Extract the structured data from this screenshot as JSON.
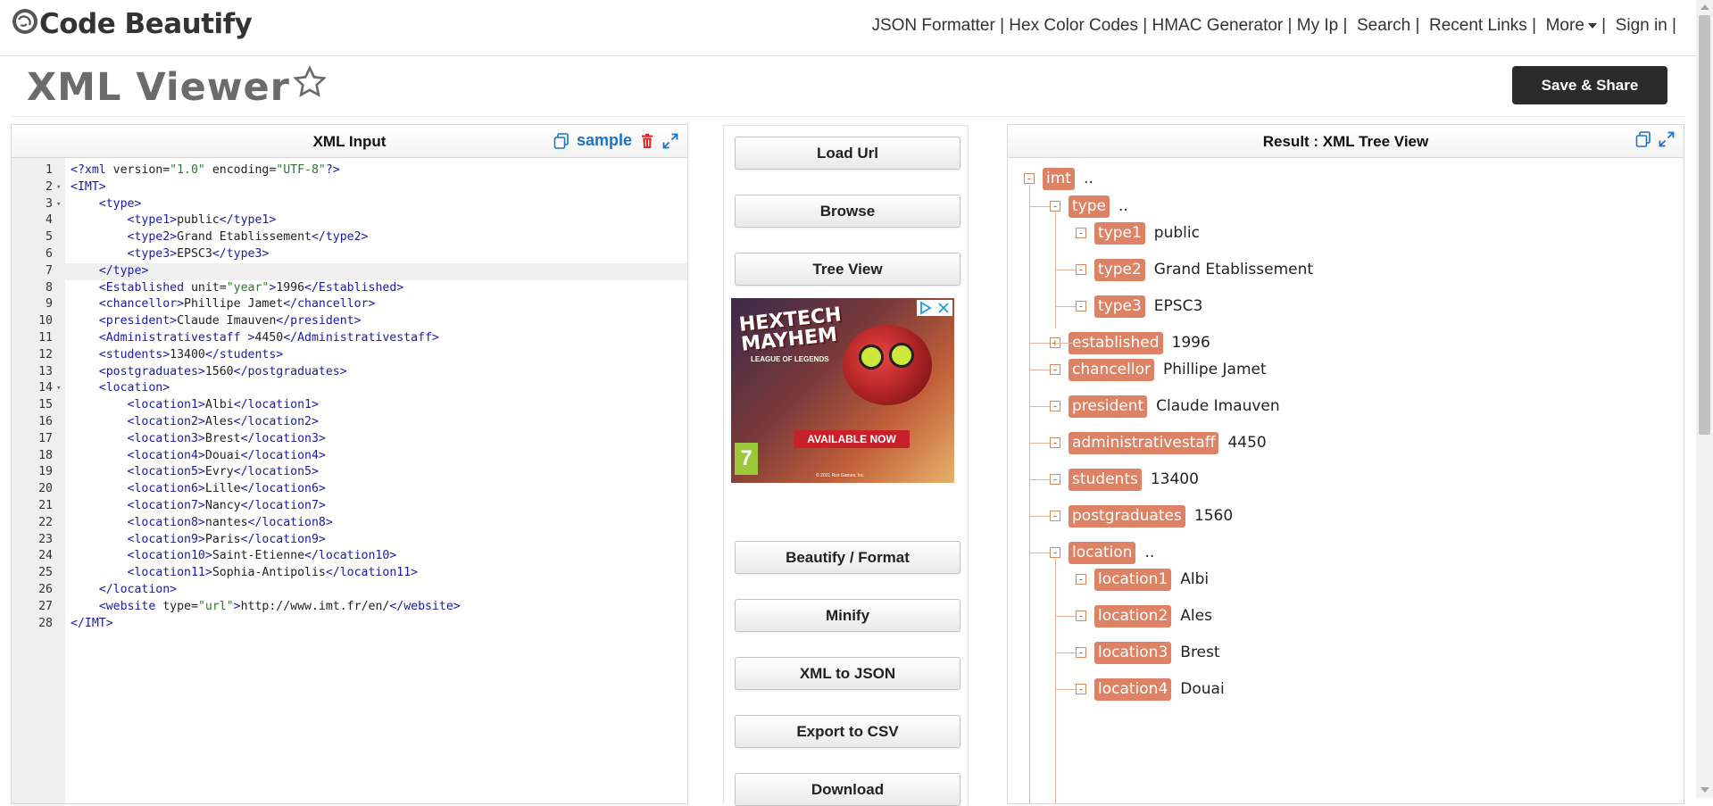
{
  "brand": {
    "name": "Code Beautify"
  },
  "nav": {
    "items": [
      "JSON Formatter",
      "Hex Color Codes",
      "HMAC Generator",
      "My Ip",
      "Search",
      "Recent Links",
      "More",
      "Sign in"
    ]
  },
  "page": {
    "title": "XML Viewer",
    "save_label": "Save & Share"
  },
  "input_panel": {
    "title": "XML Input",
    "sample_label": "sample",
    "lines": [
      {
        "n": "1",
        "fold": "",
        "segs": [
          [
            "t",
            "<?xml"
          ],
          [
            "a",
            " version="
          ],
          [
            "v",
            "\"1.0\""
          ],
          [
            "a",
            " encoding="
          ],
          [
            "v",
            "\"UTF-8\""
          ],
          [
            "t",
            "?>"
          ]
        ]
      },
      {
        "n": "2",
        "fold": "▾",
        "segs": [
          [
            "t",
            "<IMT>"
          ]
        ]
      },
      {
        "n": "3",
        "fold": "▾",
        "segs": [
          [
            "a",
            "    "
          ],
          [
            "t",
            "<type>"
          ]
        ]
      },
      {
        "n": "4",
        "fold": "",
        "segs": [
          [
            "a",
            "        "
          ],
          [
            "t",
            "<type1>"
          ],
          [
            "a",
            "public"
          ],
          [
            "t",
            "</type1>"
          ]
        ]
      },
      {
        "n": "5",
        "fold": "",
        "segs": [
          [
            "a",
            "        "
          ],
          [
            "t",
            "<type2>"
          ],
          [
            "a",
            "Grand Etablissement"
          ],
          [
            "t",
            "</type2>"
          ]
        ]
      },
      {
        "n": "6",
        "fold": "",
        "segs": [
          [
            "a",
            "        "
          ],
          [
            "t",
            "<type3>"
          ],
          [
            "a",
            "EPSC3"
          ],
          [
            "t",
            "</type3>"
          ]
        ]
      },
      {
        "n": "7",
        "fold": "",
        "segs": [
          [
            "a",
            "    "
          ],
          [
            "t",
            "</type>"
          ]
        ]
      },
      {
        "n": "8",
        "fold": "",
        "segs": [
          [
            "a",
            "    "
          ],
          [
            "t",
            "<Established"
          ],
          [
            "a",
            " unit="
          ],
          [
            "v",
            "\"year\""
          ],
          [
            "t",
            ">"
          ],
          [
            "a",
            "1996"
          ],
          [
            "t",
            "</Established>"
          ]
        ]
      },
      {
        "n": "9",
        "fold": "",
        "segs": [
          [
            "a",
            "    "
          ],
          [
            "t",
            "<chancellor>"
          ],
          [
            "a",
            "Phillipe Jamet"
          ],
          [
            "t",
            "</chancellor>"
          ]
        ]
      },
      {
        "n": "10",
        "fold": "",
        "segs": [
          [
            "a",
            "    "
          ],
          [
            "t",
            "<president>"
          ],
          [
            "a",
            "Claude Imauven"
          ],
          [
            "t",
            "</president>"
          ]
        ]
      },
      {
        "n": "11",
        "fold": "",
        "segs": [
          [
            "a",
            "    "
          ],
          [
            "t",
            "<Administrativestaff >"
          ],
          [
            "a",
            "4450"
          ],
          [
            "t",
            "</Administrativestaff>"
          ]
        ]
      },
      {
        "n": "12",
        "fold": "",
        "segs": [
          [
            "a",
            "    "
          ],
          [
            "t",
            "<students>"
          ],
          [
            "a",
            "13400"
          ],
          [
            "t",
            "</students>"
          ]
        ]
      },
      {
        "n": "13",
        "fold": "",
        "segs": [
          [
            "a",
            "    "
          ],
          [
            "t",
            "<postgraduates>"
          ],
          [
            "a",
            "1560"
          ],
          [
            "t",
            "</postgraduates>"
          ]
        ]
      },
      {
        "n": "14",
        "fold": "▾",
        "segs": [
          [
            "a",
            "    "
          ],
          [
            "t",
            "<location>"
          ]
        ]
      },
      {
        "n": "15",
        "fold": "",
        "segs": [
          [
            "a",
            "        "
          ],
          [
            "t",
            "<location1>"
          ],
          [
            "a",
            "Albi"
          ],
          [
            "t",
            "</location1>"
          ]
        ]
      },
      {
        "n": "16",
        "fold": "",
        "segs": [
          [
            "a",
            "        "
          ],
          [
            "t",
            "<location2>"
          ],
          [
            "a",
            "Ales"
          ],
          [
            "t",
            "</location2>"
          ]
        ]
      },
      {
        "n": "17",
        "fold": "",
        "segs": [
          [
            "a",
            "        "
          ],
          [
            "t",
            "<location3>"
          ],
          [
            "a",
            "Brest"
          ],
          [
            "t",
            "</location3>"
          ]
        ]
      },
      {
        "n": "18",
        "fold": "",
        "segs": [
          [
            "a",
            "        "
          ],
          [
            "t",
            "<location4>"
          ],
          [
            "a",
            "Douai"
          ],
          [
            "t",
            "</location4>"
          ]
        ]
      },
      {
        "n": "19",
        "fold": "",
        "segs": [
          [
            "a",
            "        "
          ],
          [
            "t",
            "<location5>"
          ],
          [
            "a",
            "Evry"
          ],
          [
            "t",
            "</location5>"
          ]
        ]
      },
      {
        "n": "20",
        "fold": "",
        "segs": [
          [
            "a",
            "        "
          ],
          [
            "t",
            "<location6>"
          ],
          [
            "a",
            "Lille"
          ],
          [
            "t",
            "</location6>"
          ]
        ]
      },
      {
        "n": "21",
        "fold": "",
        "segs": [
          [
            "a",
            "        "
          ],
          [
            "t",
            "<location7>"
          ],
          [
            "a",
            "Nancy"
          ],
          [
            "t",
            "</location7>"
          ]
        ]
      },
      {
        "n": "22",
        "fold": "",
        "segs": [
          [
            "a",
            "        "
          ],
          [
            "t",
            "<location8>"
          ],
          [
            "a",
            "nantes"
          ],
          [
            "t",
            "</location8>"
          ]
        ]
      },
      {
        "n": "23",
        "fold": "",
        "segs": [
          [
            "a",
            "        "
          ],
          [
            "t",
            "<location9>"
          ],
          [
            "a",
            "Paris"
          ],
          [
            "t",
            "</location9>"
          ]
        ]
      },
      {
        "n": "24",
        "fold": "",
        "segs": [
          [
            "a",
            "        "
          ],
          [
            "t",
            "<location10>"
          ],
          [
            "a",
            "Saint-Etienne"
          ],
          [
            "t",
            "</location10>"
          ]
        ]
      },
      {
        "n": "25",
        "fold": "",
        "segs": [
          [
            "a",
            "        "
          ],
          [
            "t",
            "<location11>"
          ],
          [
            "a",
            "Sophia-Antipolis"
          ],
          [
            "t",
            "</location11>"
          ]
        ]
      },
      {
        "n": "26",
        "fold": "",
        "segs": [
          [
            "a",
            "    "
          ],
          [
            "t",
            "</location>"
          ]
        ]
      },
      {
        "n": "27",
        "fold": "",
        "segs": [
          [
            "a",
            "    "
          ],
          [
            "t",
            "<website"
          ],
          [
            "a",
            " type="
          ],
          [
            "v",
            "\"url\""
          ],
          [
            "t",
            ">"
          ],
          [
            "a",
            "http://www.imt.fr/en/"
          ],
          [
            "t",
            "</website>"
          ]
        ]
      },
      {
        "n": "28",
        "fold": "",
        "segs": [
          [
            "t",
            "</IMT>"
          ]
        ]
      }
    ]
  },
  "actions": {
    "load_url": "Load Url",
    "browse": "Browse",
    "tree_view": "Tree View",
    "beautify": "Beautify / Format",
    "minify": "Minify",
    "xml_to_json": "XML to JSON",
    "export_csv": "Export to CSV",
    "download": "Download"
  },
  "ad": {
    "title_line1": "HEXTECH",
    "title_line2": "MAYHEM",
    "subtitle": "LEAGUE OF LEGENDS",
    "banner": "AVAILABLE NOW",
    "rating": "7",
    "copyright": "© 2021 Riot Games, Inc."
  },
  "result_panel": {
    "title": "Result : XML Tree View",
    "nodes": [
      {
        "tag": "imt",
        "value": "..",
        "depth": 0,
        "expander": "-"
      },
      {
        "tag": "type",
        "value": "..",
        "depth": 1,
        "expander": "-"
      },
      {
        "tag": "type1",
        "value": "public",
        "depth": 2,
        "expander": "-"
      },
      {
        "tag": "type2",
        "value": "Grand Etablissement",
        "depth": 2,
        "expander": "-"
      },
      {
        "tag": "type3",
        "value": "EPSC3",
        "depth": 2,
        "expander": "-"
      },
      {
        "tag": "established",
        "value": "1996",
        "depth": 1,
        "expander": "+"
      },
      {
        "tag": "chancellor",
        "value": "Phillipe Jamet",
        "depth": 1,
        "expander": "-"
      },
      {
        "tag": "president",
        "value": "Claude Imauven",
        "depth": 1,
        "expander": "-"
      },
      {
        "tag": "administrativestaff",
        "value": "4450",
        "depth": 1,
        "expander": "-"
      },
      {
        "tag": "students",
        "value": "13400",
        "depth": 1,
        "expander": "-"
      },
      {
        "tag": "postgraduates",
        "value": "1560",
        "depth": 1,
        "expander": "-"
      },
      {
        "tag": "location",
        "value": "..",
        "depth": 1,
        "expander": "-"
      },
      {
        "tag": "location1",
        "value": "Albi",
        "depth": 2,
        "expander": "-"
      },
      {
        "tag": "location2",
        "value": "Ales",
        "depth": 2,
        "expander": "-"
      },
      {
        "tag": "location3",
        "value": "Brest",
        "depth": 2,
        "expander": "-"
      },
      {
        "tag": "location4",
        "value": "Douai",
        "depth": 2,
        "expander": "-"
      }
    ]
  },
  "colors": {
    "tag_bg": "#dd8264",
    "accent_blue": "#1a73c7",
    "save_bg": "#2b2b2b",
    "delete_red": "#e02828"
  }
}
